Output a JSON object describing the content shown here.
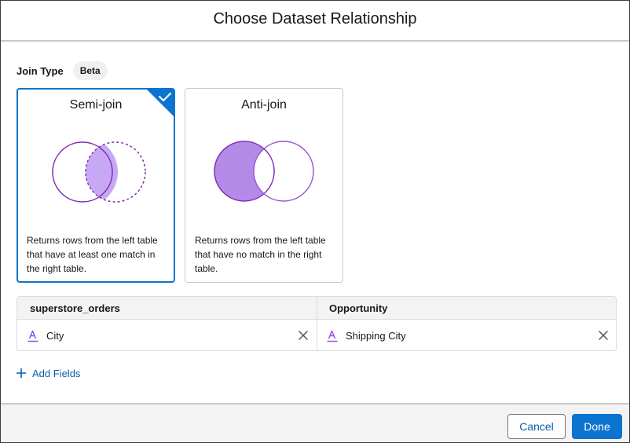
{
  "modal": {
    "title": "Choose Dataset Relationship"
  },
  "join_type": {
    "label": "Join Type",
    "badge": "Beta",
    "options": [
      {
        "title": "Semi-join",
        "description": "Returns rows from the left table that have at least one match in the right table.",
        "selected": true
      },
      {
        "title": "Anti-join",
        "description": "Returns rows from the left table that have no match in the right table.",
        "selected": false
      }
    ]
  },
  "fields": {
    "left_dataset": "superstore_orders",
    "right_dataset": "Opportunity",
    "rows": [
      {
        "left_field": "City",
        "right_field": "Shipping City"
      }
    ]
  },
  "add_fields_label": "Add Fields",
  "footer": {
    "cancel_label": "Cancel",
    "done_label": "Done"
  },
  "colors": {
    "accent": "#0b73d0",
    "venn_fill": "#c6a8f5",
    "venn_fill_strong": "#b48ae8",
    "venn_stroke": "#7d2eb3",
    "link": "#0b5cab"
  },
  "icons": {
    "selected_check": "check-icon",
    "field_type": "text-field-icon",
    "remove": "close-icon",
    "add": "plus-icon"
  }
}
